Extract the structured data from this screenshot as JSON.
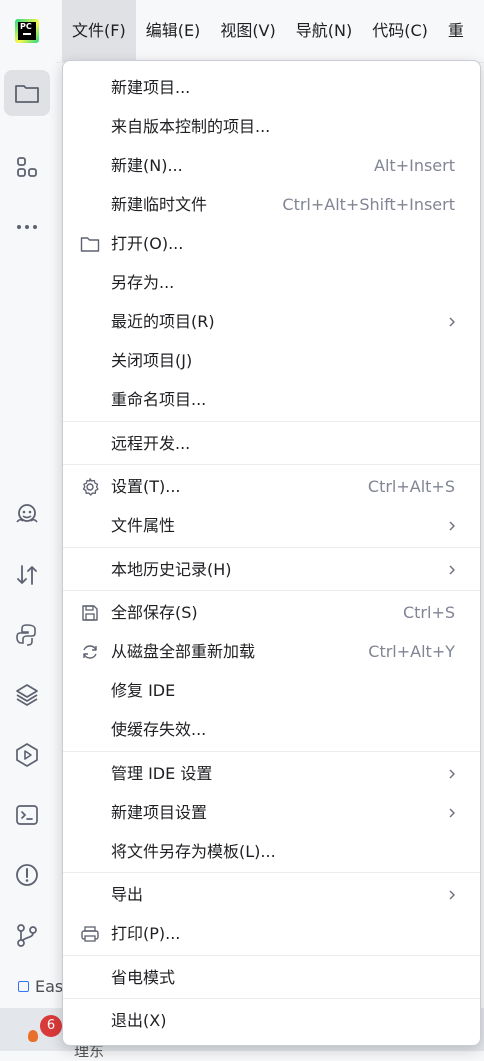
{
  "menubar": {
    "items": [
      "文件(F)",
      "编辑(E)",
      "视图(V)",
      "导航(N)",
      "代码(C)",
      "重"
    ]
  },
  "app_logo": {
    "text": "PC"
  },
  "toolstrip": {
    "icons": [
      "folder-icon",
      "structure-icon",
      "more-icon",
      "ai-assistant-icon",
      "vcs-update-icon",
      "python-console-icon",
      "layers-icon",
      "services-icon",
      "terminal-icon",
      "problems-icon",
      "git-icon"
    ]
  },
  "status": {
    "fragment": "Eas"
  },
  "taskbar": {
    "badge": "6",
    "text": "理东"
  },
  "file_menu": {
    "items": [
      {
        "label": "新建项目...",
        "shortcut": "",
        "submenu": false,
        "icon": ""
      },
      {
        "label": "来自版本控制的项目...",
        "shortcut": "",
        "submenu": false,
        "icon": ""
      },
      {
        "label": "新建(N)...",
        "shortcut": "Alt+Insert",
        "submenu": false,
        "icon": ""
      },
      {
        "label": "新建临时文件",
        "shortcut": "Ctrl+Alt+Shift+Insert",
        "submenu": false,
        "icon": ""
      },
      {
        "label": "打开(O)...",
        "shortcut": "",
        "submenu": false,
        "icon": "folder-icon"
      },
      {
        "label": "另存为...",
        "shortcut": "",
        "submenu": false,
        "icon": ""
      },
      {
        "label": "最近的项目(R)",
        "shortcut": "",
        "submenu": true,
        "icon": ""
      },
      {
        "label": "关闭项目(J)",
        "shortcut": "",
        "submenu": false,
        "icon": ""
      },
      {
        "label": "重命名项目...",
        "shortcut": "",
        "submenu": false,
        "icon": ""
      },
      {
        "label": "远程开发...",
        "shortcut": "",
        "submenu": false,
        "icon": ""
      },
      {
        "label": "设置(T)...",
        "shortcut": "Ctrl+Alt+S",
        "submenu": false,
        "icon": "gear-icon"
      },
      {
        "label": "文件属性",
        "shortcut": "",
        "submenu": true,
        "icon": ""
      },
      {
        "label": "本地历史记录(H)",
        "shortcut": "",
        "submenu": true,
        "icon": ""
      },
      {
        "label": "全部保存(S)",
        "shortcut": "Ctrl+S",
        "submenu": false,
        "icon": "save-icon"
      },
      {
        "label": "从磁盘全部重新加载",
        "shortcut": "Ctrl+Alt+Y",
        "submenu": false,
        "icon": "reload-icon"
      },
      {
        "label": "修复 IDE",
        "shortcut": "",
        "submenu": false,
        "icon": ""
      },
      {
        "label": "使缓存失效...",
        "shortcut": "",
        "submenu": false,
        "icon": ""
      },
      {
        "label": "管理 IDE 设置",
        "shortcut": "",
        "submenu": true,
        "icon": ""
      },
      {
        "label": "新建项目设置",
        "shortcut": "",
        "submenu": true,
        "icon": ""
      },
      {
        "label": "将文件另存为模板(L)...",
        "shortcut": "",
        "submenu": false,
        "icon": ""
      },
      {
        "label": "导出",
        "shortcut": "",
        "submenu": true,
        "icon": ""
      },
      {
        "label": "打印(P)...",
        "shortcut": "",
        "submenu": false,
        "icon": "printer-icon"
      },
      {
        "label": "省电模式",
        "shortcut": "",
        "submenu": false,
        "icon": ""
      },
      {
        "label": "退出(X)",
        "shortcut": "",
        "submenu": false,
        "icon": ""
      }
    ]
  },
  "colors": {
    "accent": "#3574f0",
    "menu_bg": "#ffffff",
    "shortcut": "#818594",
    "selected_bg": "#dfe1e5"
  }
}
